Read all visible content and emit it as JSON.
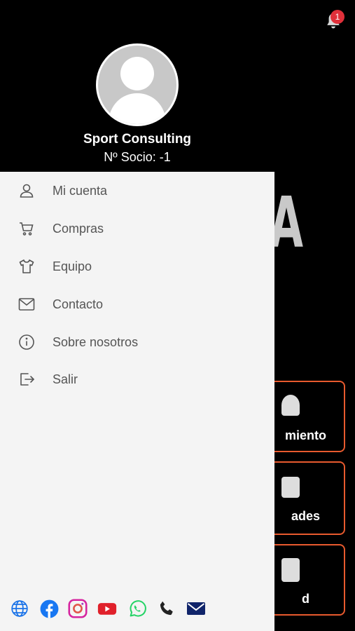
{
  "notifications": {
    "count": "1"
  },
  "profile": {
    "name": "Sport Consulting",
    "member_number": "Nº Socio: -1"
  },
  "menu": {
    "items": [
      {
        "label": "Mi cuenta",
        "icon": "user-icon"
      },
      {
        "label": "Compras",
        "icon": "cart-icon"
      },
      {
        "label": "Equipo",
        "icon": "shirt-icon"
      },
      {
        "label": "Contacto",
        "icon": "mail-icon"
      },
      {
        "label": "Sobre nosotros",
        "icon": "info-icon"
      },
      {
        "label": "Salir",
        "icon": "logout-icon"
      }
    ]
  },
  "background": {
    "big_letter": "A",
    "cards": [
      {
        "label": "miento"
      },
      {
        "label": "ades"
      },
      {
        "label": "d"
      }
    ]
  },
  "social": [
    {
      "icon": "web-icon",
      "color": "#1a73e8"
    },
    {
      "icon": "facebook-icon",
      "color": "#1877f2"
    },
    {
      "icon": "instagram-icon",
      "color": "#d6249f"
    },
    {
      "icon": "youtube-icon",
      "color": "#e0202a"
    },
    {
      "icon": "whatsapp-icon",
      "color": "#25d366"
    },
    {
      "icon": "phone-icon",
      "color": "#222222"
    },
    {
      "icon": "email-icon",
      "color": "#10246a"
    }
  ],
  "colors": {
    "accent": "#e85a2e",
    "badge": "#e0303a",
    "drawer": "#f4f4f4"
  }
}
